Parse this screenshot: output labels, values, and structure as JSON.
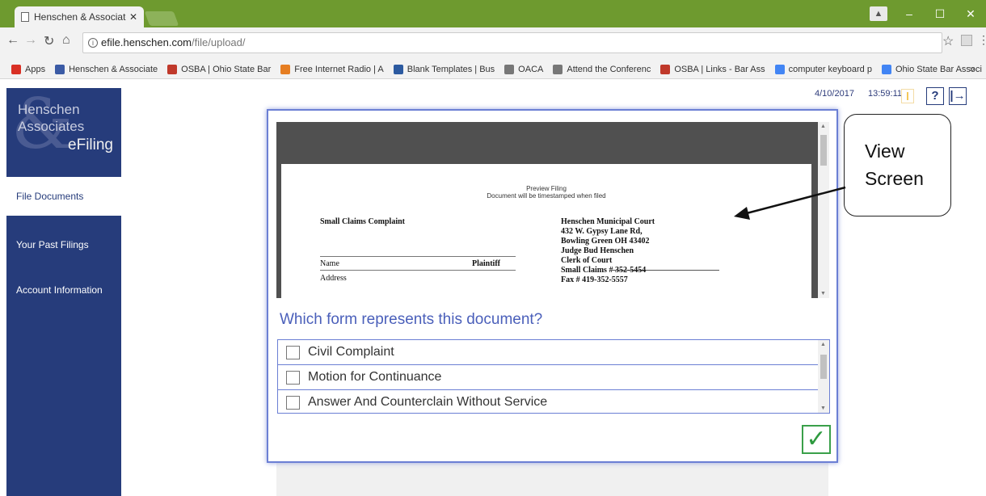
{
  "browser": {
    "tab_title": "Henschen & Associates e",
    "tab_close": "✕",
    "url_host": "efile.henschen.com",
    "url_path": "/file/upload/",
    "window_controls": {
      "minimize": "–",
      "maximize": "☐",
      "close": "✕"
    },
    "bookmarks": [
      {
        "label": "Apps",
        "icon": "apps-grid-icon",
        "color": "#d93025"
      },
      {
        "label": "Henschen & Associate",
        "icon": "henschen-favicon",
        "color": "#3b5ba5"
      },
      {
        "label": "OSBA | Ohio State Bar",
        "icon": "osba-favicon",
        "color": "#c0392b"
      },
      {
        "label": "Free Internet Radio | A",
        "icon": "radio-favicon",
        "color": "#e67e22"
      },
      {
        "label": "Blank Templates | Bus",
        "icon": "templates-favicon",
        "color": "#2c5aa0"
      },
      {
        "label": "OACA",
        "icon": "page-icon",
        "color": "#777777"
      },
      {
        "label": "Attend the Conferenc",
        "icon": "page-icon",
        "color": "#777777"
      },
      {
        "label": "OSBA | Links - Bar Ass",
        "icon": "osba-favicon",
        "color": "#c0392b"
      },
      {
        "label": "computer keyboard p",
        "icon": "google-icon",
        "color": "#4285f4"
      },
      {
        "label": "Ohio State Bar Associ",
        "icon": "google-icon",
        "color": "#4285f4"
      }
    ],
    "bookmarks_more": "»"
  },
  "sidebar": {
    "logo": {
      "line1": "Henschen",
      "line2": "Associates",
      "line3": "eFiling",
      "ampersand": "&"
    },
    "items": [
      {
        "label": "File Documents",
        "active": true
      },
      {
        "label": "Your Past Filings",
        "active": false
      },
      {
        "label": "Account Information",
        "active": false
      }
    ]
  },
  "status": {
    "date": "4/10/2017",
    "time": "13:59:11",
    "help": "?",
    "logout": "|→"
  },
  "preview": {
    "title": "Preview Filing",
    "subtitle": "Document will be timestamped when filed",
    "doc_title": "Small Claims Complaint",
    "court_lines": [
      "Henschen Municipal Court",
      "432 W. Gypsy Lane Rd,",
      "Bowling Green OH  43402",
      "Judge Bud Henschen",
      "Clerk of Court",
      "Small Claims # 352-5454",
      "Fax # 419-352-5557"
    ],
    "name_label": "Name",
    "plaintiff_label": "Plaintiff",
    "address_label": "Address"
  },
  "form_select": {
    "question": "Which form represents this document?",
    "options": [
      "Civil Complaint",
      "Motion for Continuance",
      "Answer And Counterclain Without Service"
    ]
  },
  "confirm": {
    "symbol": "✓",
    "color": "#3aa04a"
  },
  "callout": {
    "line1": "View",
    "line2": "Screen"
  },
  "colors": {
    "browser_green": "#6e9a2f",
    "sidebar_navy": "#263c7b",
    "modal_border": "#6b7fd4"
  }
}
